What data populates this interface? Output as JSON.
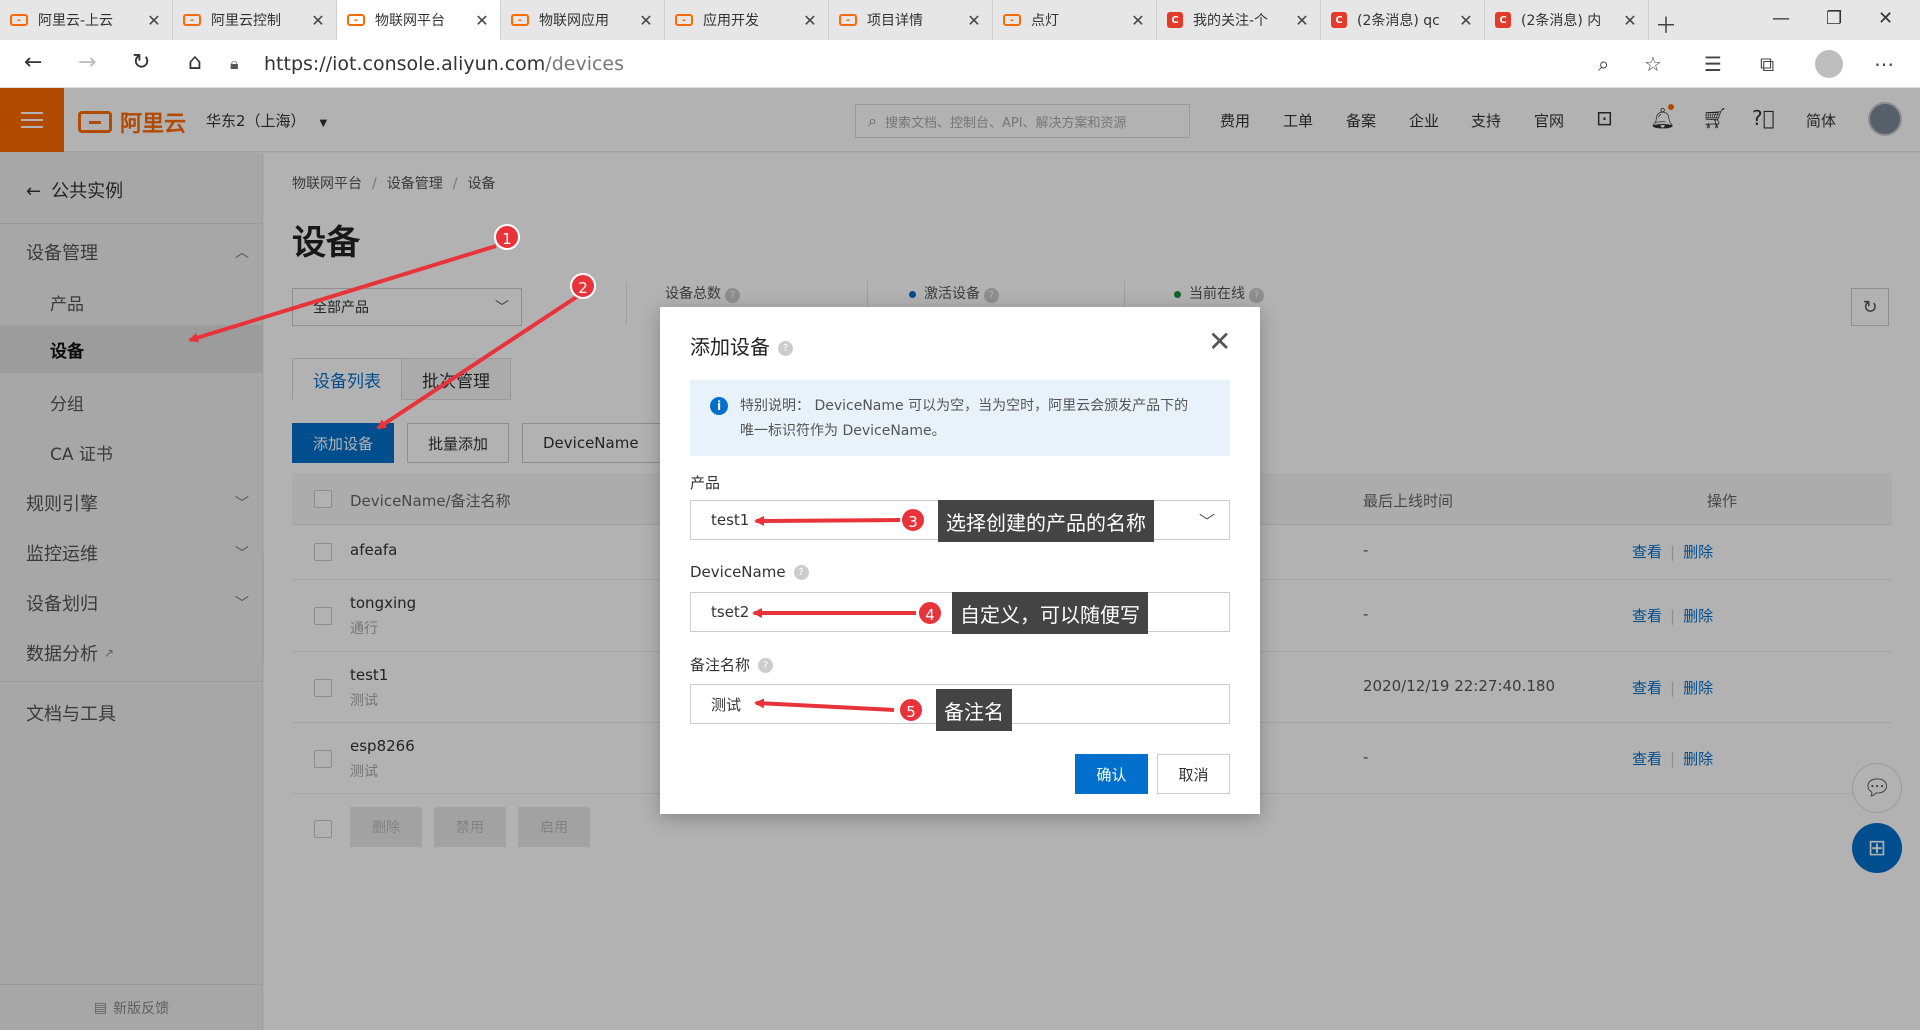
{
  "browser": {
    "tabs": [
      {
        "title": "阿里云-上云",
        "icon": "aliyun-icon",
        "active": false
      },
      {
        "title": "阿里云控制",
        "icon": "aliyun-icon",
        "active": false
      },
      {
        "title": "物联网平台",
        "icon": "aliyun-icon",
        "active": true
      },
      {
        "title": "物联网应用",
        "icon": "aliyun-icon",
        "active": false
      },
      {
        "title": "应用开发",
        "icon": "aliyun-icon",
        "active": false
      },
      {
        "title": "项目详情",
        "icon": "aliyun-icon",
        "active": false
      },
      {
        "title": "点灯",
        "icon": "aliyun-icon",
        "active": false
      },
      {
        "title": "我的关注-个",
        "icon": "csdn-icon",
        "active": false
      },
      {
        "title": "(2条消息) qc",
        "icon": "csdn-icon",
        "active": false
      },
      {
        "title": "(2条消息) 内",
        "icon": "csdn-icon",
        "active": false
      }
    ],
    "url_host": "https://iot.console.aliyun.com",
    "url_path": "/devices"
  },
  "header": {
    "logo": "阿里云",
    "region": "华东2（上海）",
    "search_placeholder": "搜索文档、控制台、API、解决方案和资源",
    "links": [
      "费用",
      "工单",
      "备案",
      "企业",
      "支持",
      "官网"
    ],
    "lang": "简体"
  },
  "sidebar": {
    "back": "公共实例",
    "items": [
      {
        "label": "设备管理",
        "type": "group",
        "expanded": true
      },
      {
        "label": "产品",
        "type": "sub"
      },
      {
        "label": "设备",
        "type": "sub",
        "selected": true
      },
      {
        "label": "分组",
        "type": "sub"
      },
      {
        "label": "CA 证书",
        "type": "sub"
      },
      {
        "label": "规则引擎",
        "type": "group"
      },
      {
        "label": "监控运维",
        "type": "group"
      },
      {
        "label": "设备划归",
        "type": "group"
      },
      {
        "label": "数据分析",
        "type": "link"
      },
      {
        "label": "文档与工具",
        "type": "plain"
      }
    ],
    "feedback": "新版反馈"
  },
  "main": {
    "breadcrumb": [
      "物联网平台",
      "设备管理",
      "设备"
    ],
    "title": "设备",
    "product_select": "全部产品",
    "stats": {
      "total": "设备总数",
      "active": "激活设备",
      "online": "当前在线"
    },
    "status_colors": {
      "active": "#0070cc",
      "online": "#1e8e3e"
    },
    "tabs": [
      "设备列表",
      "批次管理"
    ],
    "add_button": "添加设备",
    "batch_button": "批量添加",
    "filter_select": "DeviceName",
    "table": {
      "headers": {
        "name": "DeviceName/备注名称",
        "last_online": "最后上线时间",
        "ops": "操作"
      },
      "rows": [
        {
          "name": "afeafa",
          "remark": "",
          "last_online": "-"
        },
        {
          "name": "tongxing",
          "remark": "通行",
          "last_online": "-"
        },
        {
          "name": "test1",
          "remark": "测试",
          "last_online": "2020/12/19 22:27:40.180"
        },
        {
          "name": "esp8266",
          "remark": "测试",
          "last_online": "-"
        }
      ],
      "view": "查看",
      "delete": "删除"
    },
    "bulk": [
      "删除",
      "禁用",
      "启用"
    ]
  },
  "modal": {
    "title": "添加设备",
    "notice_line1": "特别说明：  DeviceName 可以为空，当为空时，阿里云会颁发产品下的",
    "notice_line2": "唯一标识符作为 DeviceName。",
    "product_label": "产品",
    "product_value": "test1",
    "devicename_label": "DeviceName",
    "devicename_value": "tset2",
    "remark_label": "备注名称",
    "remark_value": "测试",
    "confirm": "确认",
    "cancel": "取消"
  },
  "annotations": {
    "badges": [
      "1",
      "2",
      "3",
      "4",
      "5"
    ],
    "tips": [
      "选择创建的产品的名称",
      "自定义，可以随便写",
      "备注名"
    ],
    "color": "#e8333a"
  },
  "accent": "#0070cc",
  "brand": "#ff6a00"
}
